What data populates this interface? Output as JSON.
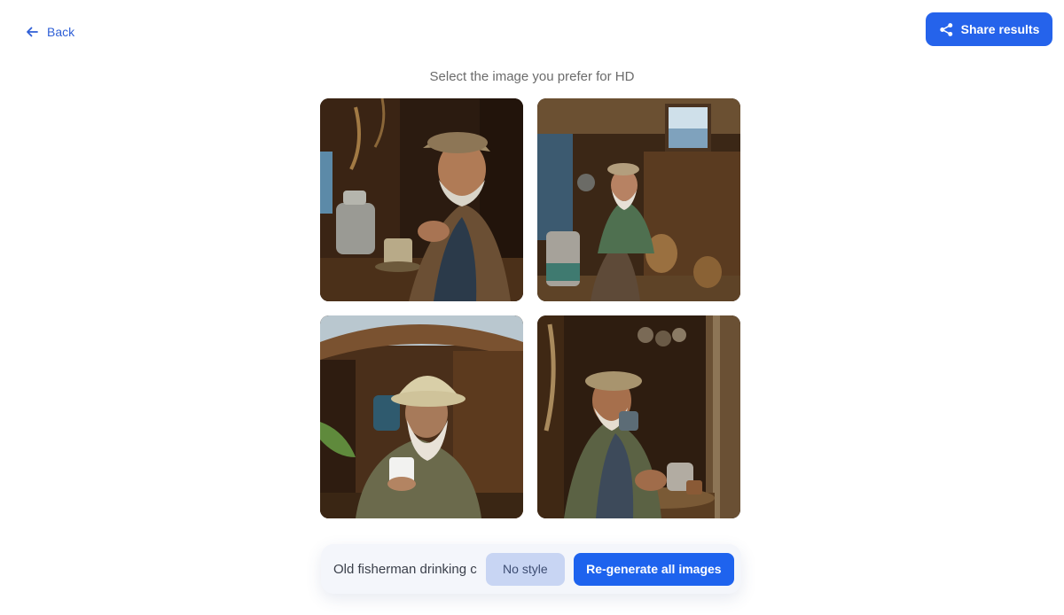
{
  "header": {
    "back_label": "Back",
    "share_label": "Share results"
  },
  "main": {
    "title": "Select the image you prefer for HD"
  },
  "images": [
    {
      "name": "fisherman-image-1",
      "description": "Old fisherman with beard and cap holding cup beside kettle"
    },
    {
      "name": "fisherman-image-2",
      "description": "Old fisherman in green sweater sitting in wooden hut with window"
    },
    {
      "name": "fisherman-image-3",
      "description": "Old fisherman with straw hat holding white mug in hut"
    },
    {
      "name": "fisherman-image-4",
      "description": "Old fisherman with cap drinking from mug at table"
    }
  ],
  "prompt_bar": {
    "prompt_value": "Old fisherman drinking coffee",
    "style_label": "No style",
    "regenerate_label": "Re-generate all images"
  },
  "colors": {
    "accent": "#2563eb",
    "style_button_bg": "#c8d5f3"
  }
}
